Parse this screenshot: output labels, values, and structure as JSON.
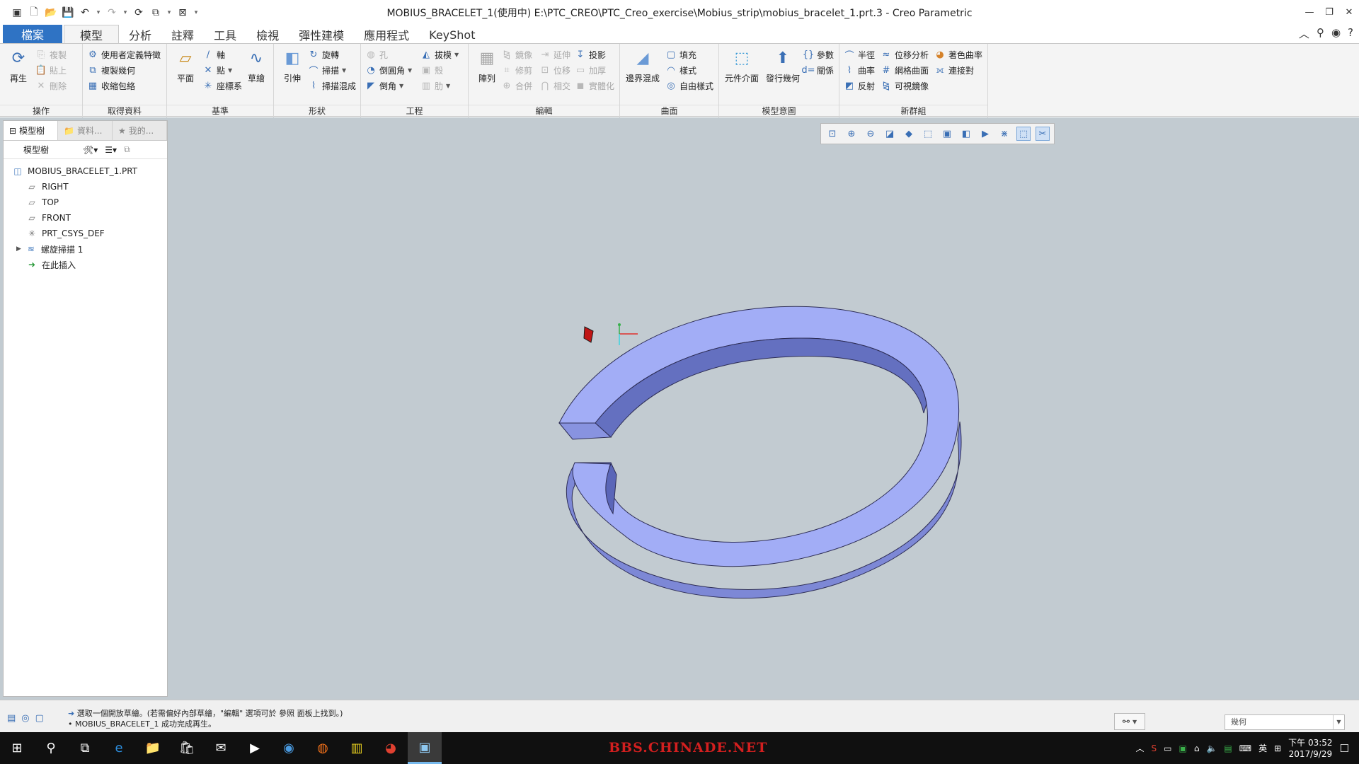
{
  "window": {
    "title": "MOBIUS_BRACELET_1(使用中) E:\\PTC_CREO\\PTC_Creo_exercise\\Mobius_strip\\mobius_bracelet_1.prt.3 - Creo Parametric"
  },
  "tabs": [
    {
      "label": "檔案"
    },
    {
      "label": "模型"
    },
    {
      "label": "分析"
    },
    {
      "label": "註釋"
    },
    {
      "label": "工具"
    },
    {
      "label": "檢視"
    },
    {
      "label": "彈性建模"
    },
    {
      "label": "應用程式"
    },
    {
      "label": "KeyShot"
    }
  ],
  "ribbon": {
    "operations": {
      "label": "操作",
      "regen": "再生",
      "copy": "複製",
      "paste": "貼上",
      "delete": "刪除"
    },
    "get_data": {
      "label": "取得資料",
      "udf": "使用者定義特徵",
      "copy_geom": "複製幾何",
      "shrinkwrap": "收縮包絡"
    },
    "datum": {
      "label": "基準",
      "plane": "平面",
      "axis": "軸",
      "point": "點",
      "csys": "座標系",
      "sketch": "草繪"
    },
    "shapes": {
      "label": "形狀",
      "extrude": "引伸",
      "revolve": "旋轉",
      "sweep": "掃描",
      "swept_blend": "掃描混成"
    },
    "engineering": {
      "label": "工程",
      "hole": "孔",
      "round": "倒圓角",
      "chamfer": "倒角",
      "draft": "拔模",
      "shell": "殼",
      "rib": "肋"
    },
    "editing": {
      "label": "編輯",
      "pattern": "陣列",
      "mirror": "鏡像",
      "trim": "修剪",
      "merge": "合併",
      "extend": "延伸",
      "offset": "位移",
      "intersect": "相交",
      "project": "投影",
      "thicken": "加厚",
      "solidify": "實體化"
    },
    "surfaces": {
      "label": "曲面",
      "boundary_blend": "邊界混成",
      "fill": "填充",
      "style": "樣式",
      "freestyle": "自由樣式"
    },
    "model_intent": {
      "label": "模型意圖",
      "component_interface": "元件介面",
      "publish_geom": "發行幾何",
      "parameters": "參數",
      "relations": "關係"
    },
    "new_group": {
      "label": "新群組",
      "radius": "半徑",
      "offset_analysis": "位移分析",
      "color_curvature": "著色曲率",
      "curvature": "曲率",
      "mesh_surface": "網格曲面",
      "connection": "連接對",
      "reflection": "反射",
      "visible_mirror": "可視鏡像"
    }
  },
  "navigator": {
    "tabs": [
      {
        "label": "模型樹"
      },
      {
        "label": "資料..."
      },
      {
        "label": "我的..."
      }
    ],
    "tree_label": "模型樹",
    "nodes": [
      {
        "label": "MOBIUS_BRACELET_1.PRT"
      },
      {
        "label": "RIGHT"
      },
      {
        "label": "TOP"
      },
      {
        "label": "FRONT"
      },
      {
        "label": "PRT_CSYS_DEF"
      },
      {
        "label": "螺旋掃描 1"
      },
      {
        "label": "在此插入"
      }
    ]
  },
  "status": {
    "message1": "選取一個開放草繪。(若需偏好內部草繪，\"編輯\" 選項可於 參照 面板上找到。)",
    "message2": "MOBIUS_BRACELET_1 成功完成再生。",
    "filter_value": "幾何"
  },
  "taskbar": {
    "watermark": "BBS.CHINADE.NET",
    "ime": "英",
    "time": "下午 03:52",
    "date": "2017/9/29"
  },
  "colors": {
    "model_face": "#9aa6f2",
    "model_side": "#6d79c8",
    "viewport_bg": "#c2cbd1",
    "file_tab": "#2f73c4"
  }
}
